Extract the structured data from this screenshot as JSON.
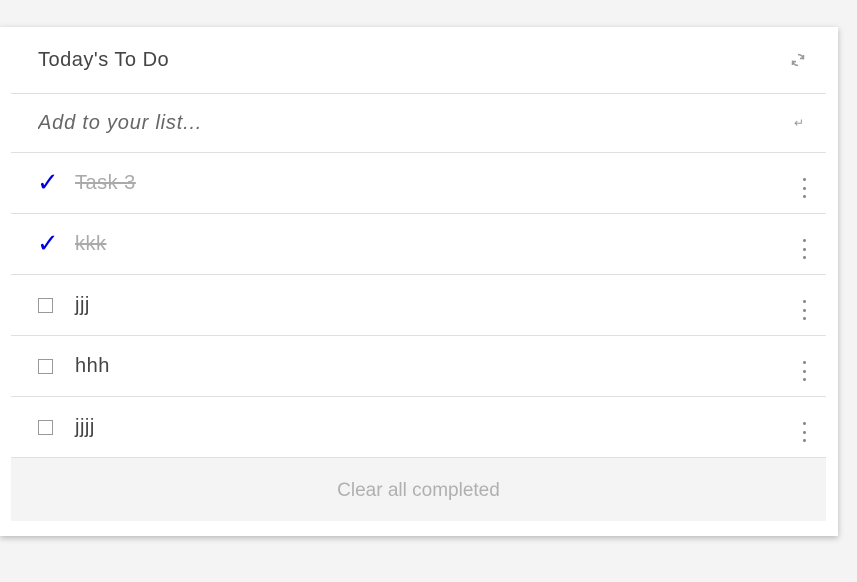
{
  "header": {
    "title": "Today's To Do",
    "refresh_icon": "refresh-icon"
  },
  "add": {
    "placeholder": "Add to your list...",
    "enter_icon": "↵"
  },
  "tasks": [
    {
      "label": "Task 3",
      "completed": true
    },
    {
      "label": "kkk",
      "completed": true
    },
    {
      "label": "jjj",
      "completed": false
    },
    {
      "label": "hhh",
      "completed": false
    },
    {
      "label": "jjjj",
      "completed": false
    }
  ],
  "footer": {
    "clear_label": "Clear all completed"
  },
  "colors": {
    "check": "#0000dd",
    "done_text": "#aaaaaa",
    "footer_bg": "#f4f4f4"
  }
}
